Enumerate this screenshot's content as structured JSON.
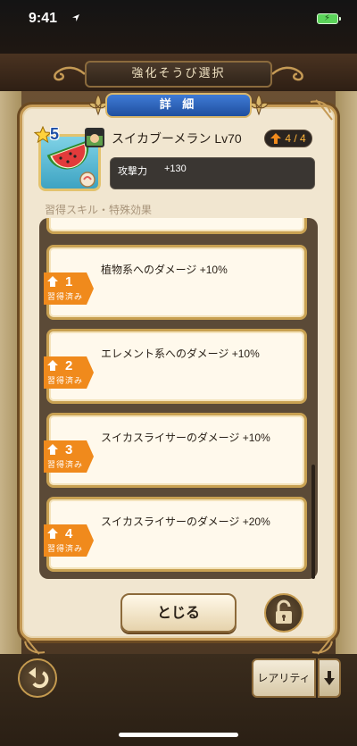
{
  "status_bar": {
    "time": "9:41"
  },
  "header": {
    "title": "強化そうび選択"
  },
  "panel": {
    "title": "詳 細"
  },
  "item": {
    "stars": "5",
    "name": "スイカブーメラン Lv70",
    "upgrade": "4 / 4",
    "stat_label": "攻撃力",
    "stat_value": "+130"
  },
  "skills_section_label": "習得スキル・特殊効果",
  "skills": [
    {
      "level": "1",
      "status": "習得済み",
      "text": "植物系へのダメージ +10%"
    },
    {
      "level": "2",
      "status": "習得済み",
      "text": "エレメント系へのダメージ +10%"
    },
    {
      "level": "3",
      "status": "習得済み",
      "text": "スイカスライサーのダメージ +10%"
    },
    {
      "level": "4",
      "status": "習得済み",
      "text": "スイカスライサーのダメージ +20%"
    }
  ],
  "buttons": {
    "close": "とじる",
    "rarity": "レアリティ"
  },
  "icons": {
    "location": "location-arrow-icon",
    "battery": "battery-charging-icon",
    "lock": "lock-icon",
    "back": "back-arrow-icon",
    "sort": "sort-down-icon"
  },
  "colors": {
    "accent_orange": "#f08a1c",
    "gold": "#c59a55",
    "blue_banner": "#2f64bd"
  }
}
